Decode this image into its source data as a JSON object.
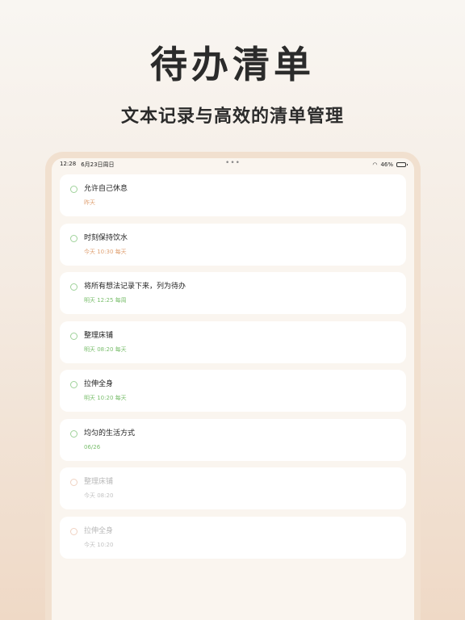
{
  "hero": {
    "title": "待办清单",
    "subtitle": "文本记录与高效的清单管理"
  },
  "status_bar": {
    "time": "12:28",
    "date": "6月23日周日",
    "dots": "•••",
    "wifi_icon": "wifi-icon",
    "battery": "46%",
    "battery_level": 0.46
  },
  "colors": {
    "accent_green": "#7bbf6e",
    "accent_orange": "#e0a274",
    "faded_text": "#b9b9b9"
  },
  "tasks": [
    {
      "title": "允许自己休息",
      "meta": "昨天",
      "tone": "orange",
      "faded": false
    },
    {
      "title": "时刻保持饮水",
      "meta": "今天 10:30 每天",
      "tone": "orange",
      "faded": false
    },
    {
      "title": "将所有想法记录下来，列为待办",
      "meta": "明天 12:25 每周",
      "tone": "green",
      "faded": false
    },
    {
      "title": "整理床铺",
      "meta": "明天 08:20 每天",
      "tone": "green",
      "faded": false
    },
    {
      "title": "拉伸全身",
      "meta": "明天 10:20 每天",
      "tone": "green",
      "faded": false
    },
    {
      "title": "均匀的生活方式",
      "meta": "06/26",
      "tone": "green",
      "faded": false
    },
    {
      "title": "整理床铺",
      "meta": "今天 08:20",
      "tone": "grey",
      "faded": true
    },
    {
      "title": "拉伸全身",
      "meta": "今天 10:20",
      "tone": "grey",
      "faded": true
    }
  ]
}
